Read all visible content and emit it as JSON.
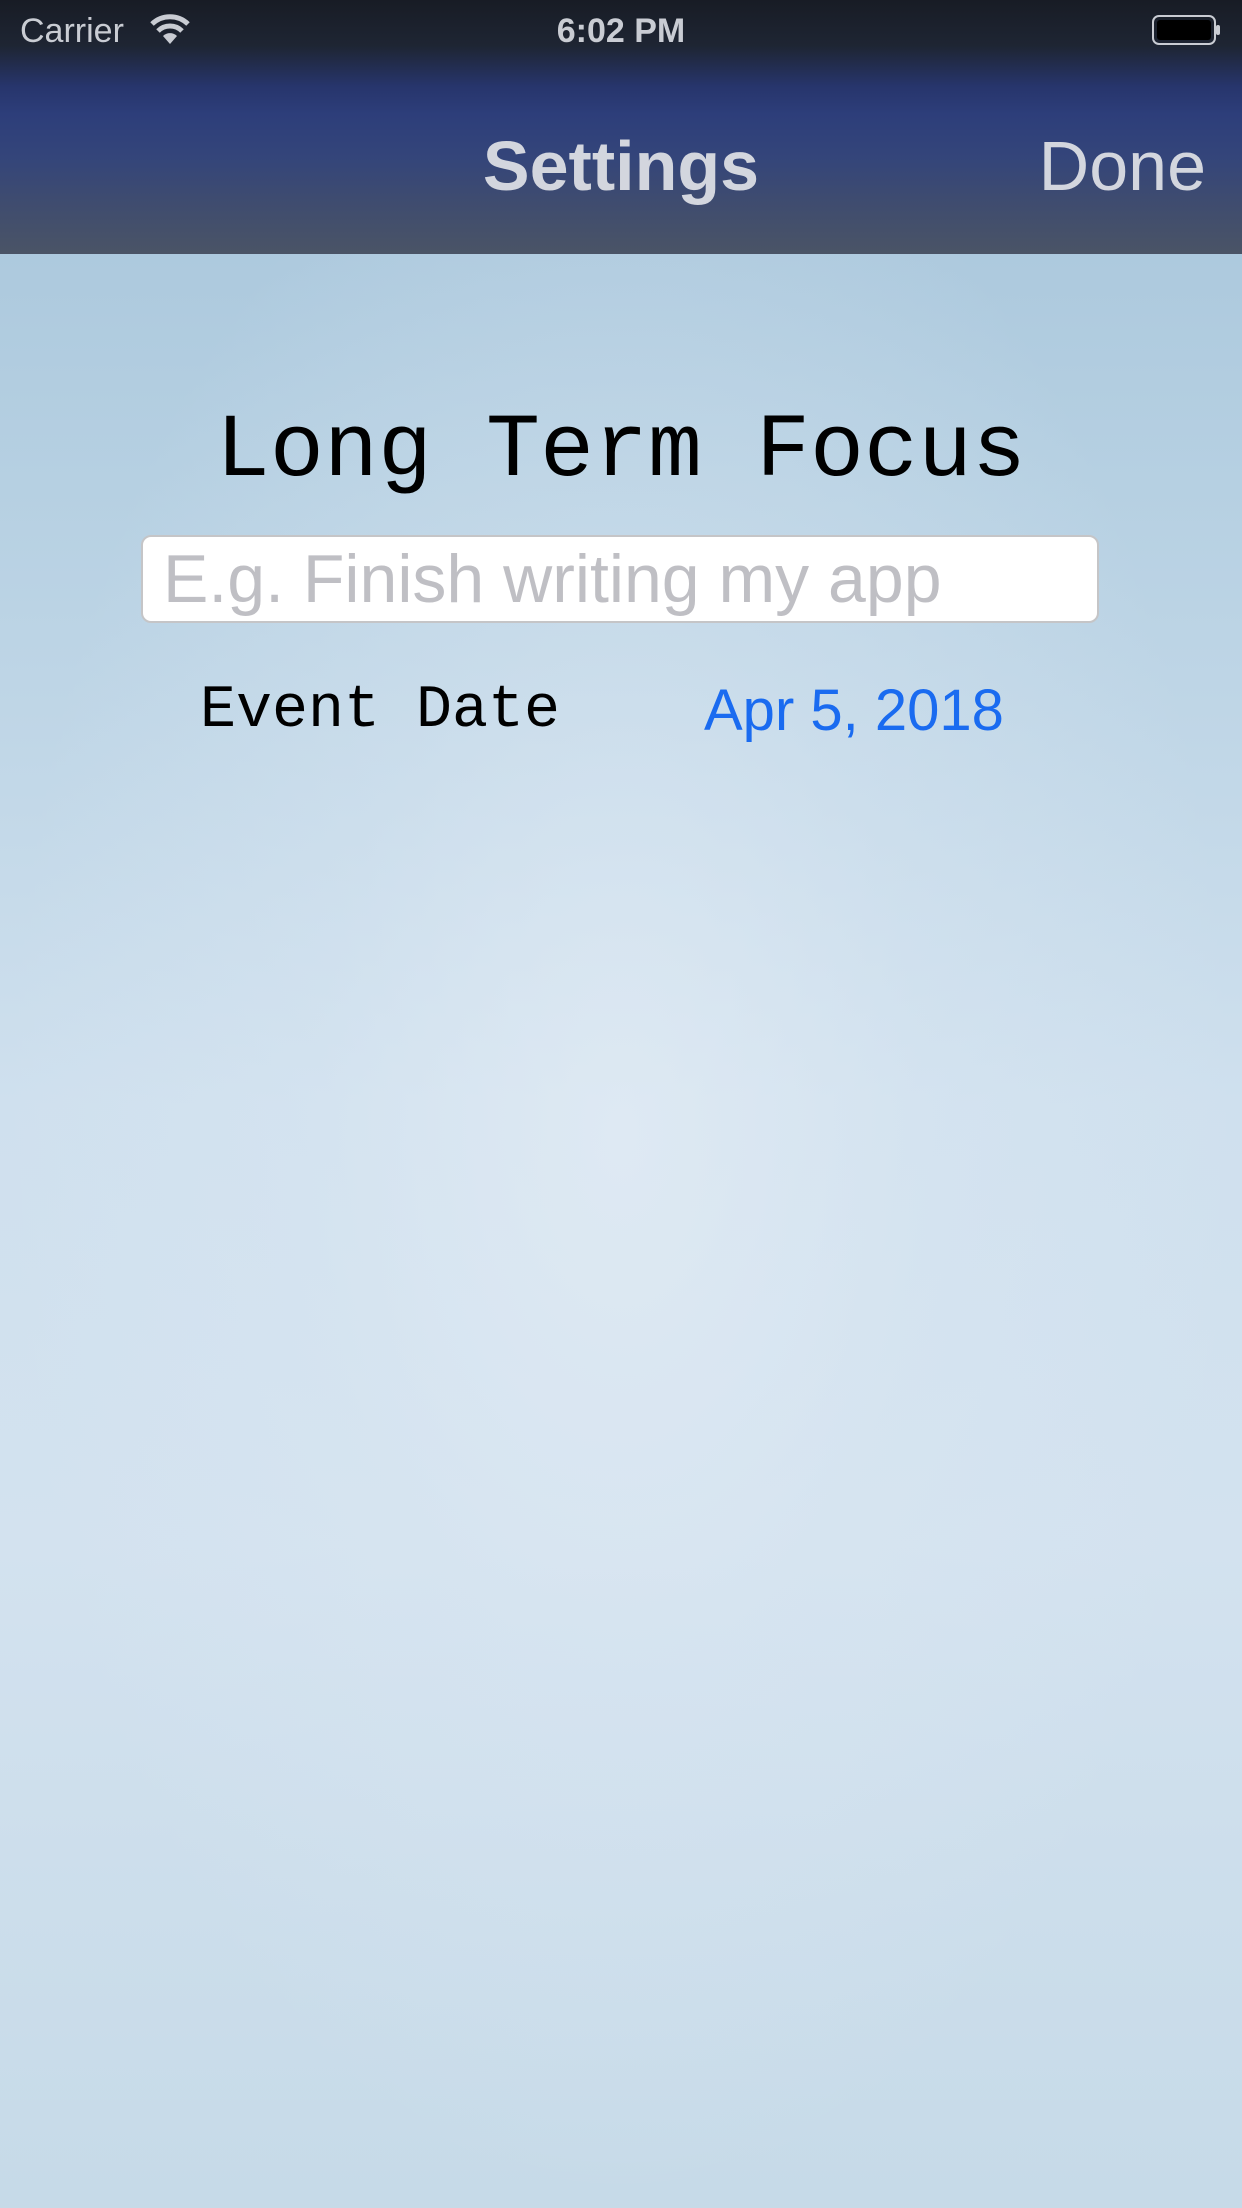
{
  "status_bar": {
    "carrier": "Carrier",
    "time": "6:02 PM",
    "wifi_icon": "wifi-icon",
    "battery_icon": "battery-icon"
  },
  "nav_bar": {
    "title": "Settings",
    "done_label": "Done"
  },
  "main": {
    "heading": "Long Term Focus",
    "focus_input": {
      "value": "",
      "placeholder": "E.g. Finish writing my app"
    },
    "event_date_label": "Event Date",
    "event_date_value": "Apr 5, 2018"
  },
  "colors": {
    "accent": "#1a6bf0",
    "nav_text": "#d3d6de"
  }
}
